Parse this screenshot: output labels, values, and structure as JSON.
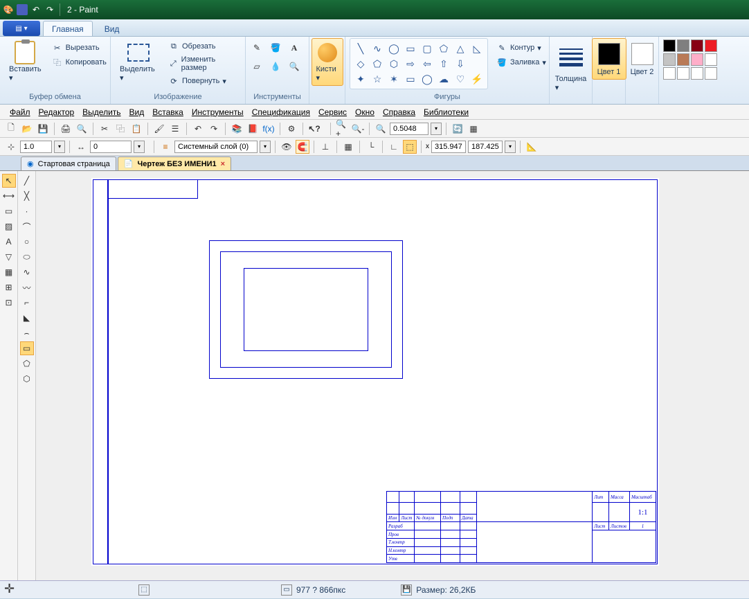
{
  "window": {
    "title": "2 - Paint"
  },
  "ribbon": {
    "tabs": {
      "file": "",
      "home": "Главная",
      "view": "Вид"
    },
    "groups": {
      "clipboard": {
        "label": "Буфер обмена",
        "paste": "Вставить",
        "cut": "Вырезать",
        "copy": "Копировать"
      },
      "image": {
        "label": "Изображение",
        "select": "Выделить",
        "crop": "Обрезать",
        "resize": "Изменить размер",
        "rotate": "Повернуть"
      },
      "tools": {
        "label": "Инструменты"
      },
      "brushes": {
        "label": "Кисти"
      },
      "shapes": {
        "label": "Фигуры",
        "outline": "Контур",
        "fill": "Заливка"
      },
      "thickness": {
        "label": "Толщина"
      },
      "color1": {
        "label": "Цвет 1"
      },
      "color2": {
        "label": "Цвет 2"
      }
    }
  },
  "palette": [
    "#000000",
    "#7f7f7f",
    "#880015",
    "#ed1c24",
    "#c3c3c3",
    "#b97a57",
    "#ffaec9",
    "#ff7f27"
  ],
  "cad": {
    "menubar": [
      "Файл",
      "Редактор",
      "Выделить",
      "Вид",
      "Вставка",
      "Инструменты",
      "Спецификация",
      "Сервис",
      "Окно",
      "Справка",
      "Библиотеки"
    ],
    "zoom_value": "0.5048",
    "scale": "1.0",
    "spin": "0",
    "layer": "Системный слой (0)",
    "coordX": "315.947",
    "coordY": "187.425",
    "tabs": {
      "start": "Стартовая страница",
      "drawing": "Чертеж БЕЗ ИМЕНИ1"
    },
    "titleblock": {
      "hdr": [
        "Изм",
        "Лист",
        "№ докум",
        "Подп",
        "Дата"
      ],
      "rows": [
        "Разраб",
        "Пров",
        "Т.контр",
        "",
        "Н.контр",
        "Утв"
      ],
      "cols": [
        "Лит",
        "Масса",
        "Масштаб"
      ],
      "scale": "1:1",
      "foot": [
        "Лист",
        "Листов",
        "1"
      ]
    }
  },
  "status": {
    "cross": "✛",
    "dims": "977 ? 866пкс",
    "size": "Размер: 26,2КБ"
  }
}
